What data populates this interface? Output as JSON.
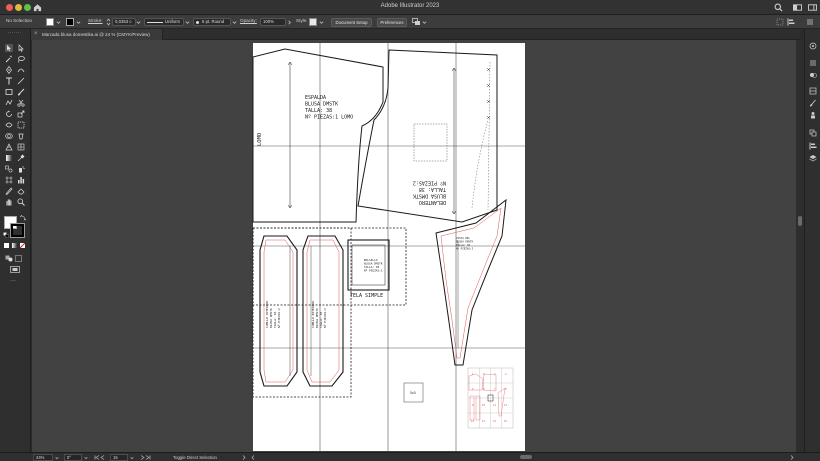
{
  "window": {
    "app_title": "Adobe Illustrator 2023"
  },
  "control_bar": {
    "selection_status": "No Selection",
    "stroke_label": "Stroke:",
    "stroke_weight": "0,0353 c",
    "stroke_profile": "Uniform",
    "brush": "5 pt. Round",
    "opacity_label": "Opacity:",
    "opacity_value": "100%",
    "style_label": "Style:",
    "document_setup_label": "Document Setup",
    "preferences_label": "Preferences"
  },
  "document_tab": {
    "title": "Marcada blusa domestika.ai @ 24 % (CMYK/Preview)"
  },
  "artboard": {
    "espalda_lines": [
      "ESPALDA",
      "BLUSA DMSTK",
      "TALLA: 38",
      "Nº PIEZAS:1 LOMO"
    ],
    "lomo_label": "LOMO",
    "delantero_lines": [
      "DELANTERO",
      "BLUSA DMSTK",
      "TALLA: 38",
      "Nº PIEZAS:2"
    ],
    "bolsillo_lines": [
      "BOLSILLO",
      "BLUSA DMSTK",
      "TALLA: 38",
      "Nº PIEZAS:1"
    ],
    "tela_simple_label": "TELA SIMPLE",
    "cuello_left_lines": [
      "CUELLO INTERIOR",
      "BLUSA DMSTK",
      "TALLA: 38",
      "Nº PIEZAS:2"
    ],
    "cuello_right_lines": [
      "CUELLO EXTERIOR",
      "BLUSA DMSTK",
      "TALLA: 38",
      "Nº PIEZAS:2"
    ],
    "vista_lines": [
      "VISTA DEL",
      "BLUSA DMSTK",
      "TALLA: 38",
      "Nº PIEZAS:2"
    ],
    "scale_box_label": "5x5",
    "thumbnail_numbers": [
      "1",
      "2",
      "3",
      "4",
      "5",
      "6",
      "7",
      "8",
      "9",
      "10",
      "11",
      "12",
      "13",
      "14",
      "15",
      "16"
    ]
  },
  "status_bar": {
    "zoom": "24%",
    "rotation": "0°",
    "artboard_number": "15",
    "status_text": "Toggle Direct Selection"
  },
  "colors": {
    "pattern_stroke": "#1a1a1a",
    "seam_line": "#e05050",
    "guide_line": "#6b6b6b",
    "canvas_bg": "#424242",
    "artboard_bg": "#ffffff"
  }
}
